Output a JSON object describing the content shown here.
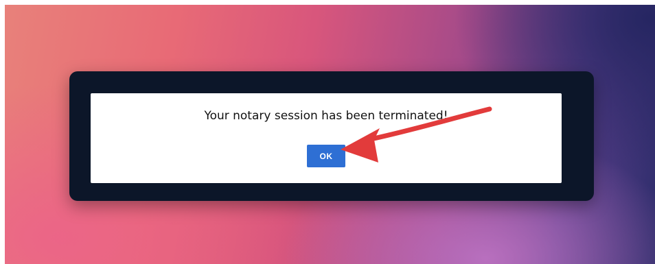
{
  "dialog": {
    "message": "Your notary session has been terminated!",
    "ok_label": "OK"
  },
  "annotation": {
    "arrow_color": "#e23b3b",
    "icon": "arrow-icon"
  },
  "colors": {
    "dialog_frame": "#0c1629",
    "button": "#2e6fd4"
  }
}
